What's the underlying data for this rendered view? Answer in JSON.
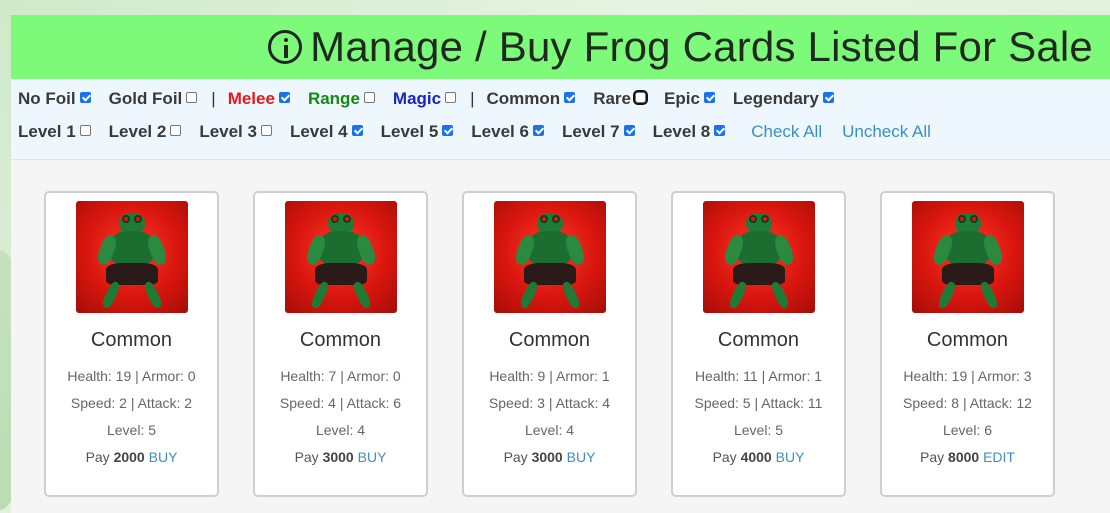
{
  "title": "Manage / Buy Frog Cards Listed For Sale",
  "title_icon": "info-circle-icon",
  "filters": {
    "row1": [
      {
        "label": "No Foil",
        "checked": true,
        "color": "#3a3a3a"
      },
      {
        "label": "Gold Foil",
        "checked": false,
        "color": "#3a3a3a"
      },
      {
        "sep": "|"
      },
      {
        "label": "Melee",
        "checked": true,
        "color": "#e8191b"
      },
      {
        "label": "Range",
        "checked": false,
        "color": "#138a13"
      },
      {
        "label": "Magic",
        "checked": false,
        "color": "#1a22c9"
      },
      {
        "sep": "|"
      },
      {
        "label": "Common",
        "checked": true,
        "color": "#3a3a3a"
      },
      {
        "label": "Rare",
        "checked": false,
        "color": "#3a3a3a",
        "focused": true
      },
      {
        "label": "Epic",
        "checked": true,
        "color": "#3a3a3a"
      },
      {
        "label": "Legendary",
        "checked": true,
        "color": "#3a3a3a"
      }
    ],
    "row2": [
      {
        "label": "Level 1",
        "checked": false
      },
      {
        "label": "Level 2",
        "checked": false
      },
      {
        "label": "Level 3",
        "checked": false
      },
      {
        "label": "Level 4",
        "checked": true
      },
      {
        "label": "Level 5",
        "checked": true
      },
      {
        "label": "Level 6",
        "checked": true
      },
      {
        "label": "Level 7",
        "checked": true
      },
      {
        "label": "Level 8",
        "checked": true
      }
    ],
    "check_all": "Check All",
    "uncheck_all": "Uncheck All"
  },
  "cards": [
    {
      "rarity": "Common",
      "stats1": "Health: 19 | Armor: 0",
      "stats2": "Speed: 2 | Attack: 2",
      "level": "Level: 5",
      "pay_prefix": "Pay",
      "price": "2000",
      "action": "BUY"
    },
    {
      "rarity": "Common",
      "stats1": "Health: 7 | Armor: 0",
      "stats2": "Speed: 4 | Attack: 6",
      "level": "Level: 4",
      "pay_prefix": "Pay",
      "price": "3000",
      "action": "BUY"
    },
    {
      "rarity": "Common",
      "stats1": "Health: 9 | Armor: 1",
      "stats2": "Speed: 3 | Attack: 4",
      "level": "Level: 4",
      "pay_prefix": "Pay",
      "price": "3000",
      "action": "BUY"
    },
    {
      "rarity": "Common",
      "stats1": "Health: 11 | Armor: 1",
      "stats2": "Speed: 5 | Attack: 11",
      "level": "Level: 5",
      "pay_prefix": "Pay",
      "price": "4000",
      "action": "BUY"
    },
    {
      "rarity": "Common",
      "stats1": "Health: 19 | Armor: 3",
      "stats2": "Speed: 8 | Attack: 12",
      "level": "Level: 6",
      "pay_prefix": "Pay",
      "price": "8000",
      "action": "EDIT"
    }
  ],
  "colors": {
    "title_bar": "#7dfa7a",
    "link": "#3b8fc4",
    "checkbox_on": "#1a73e8"
  }
}
